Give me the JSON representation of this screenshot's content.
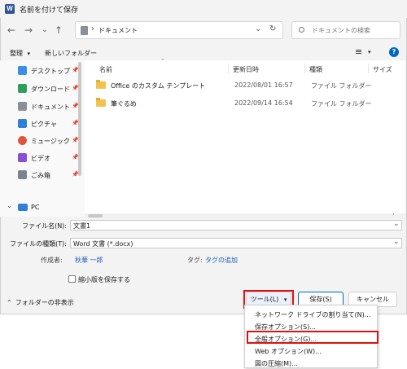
{
  "window": {
    "title": "名前を付けて保存",
    "app_icon_letter": "W",
    "app_color": "#2b579a"
  },
  "nav": {
    "back": "←",
    "forward": "→",
    "dropdown": "⌄",
    "up": "↑"
  },
  "address": {
    "separator": "›",
    "current": "ドキュメント",
    "chevron": "⌄",
    "refresh": "↻"
  },
  "search": {
    "placeholder": "ドキュメントの検索"
  },
  "toolbar": {
    "organize": "整理",
    "organize_arrow": "▾",
    "new_folder": "新しいフォルダー",
    "view_icon": "≡",
    "view_arrow": "▾",
    "help": "?"
  },
  "sidebar": {
    "items": [
      {
        "label": "デスクトップ",
        "icon": "desktop-icon",
        "color": "#3a8ee6",
        "pinned": true
      },
      {
        "label": "ダウンロード",
        "icon": "download-icon",
        "color": "#2f9e5d",
        "pinned": true
      },
      {
        "label": "ドキュメント",
        "icon": "document-icon",
        "color": "#8a8f98",
        "pinned": true
      },
      {
        "label": "ピクチャ",
        "icon": "picture-icon",
        "color": "#2f7fd8",
        "pinned": true
      },
      {
        "label": "ミュージック",
        "icon": "music-icon",
        "color": "#e0543c",
        "pinned": true
      },
      {
        "label": "ビデオ",
        "icon": "video-icon",
        "color": "#8a4fd6",
        "pinned": true
      },
      {
        "label": "ごみ箱",
        "icon": "recycle-bin-icon",
        "color": "#7a8491",
        "pinned": true
      }
    ],
    "pc": {
      "label": "PC",
      "chevron": "⌄"
    },
    "pin_glyph": "📌"
  },
  "columns": {
    "name": "名前",
    "date": "更新日時",
    "type": "種類",
    "size": "サイズ"
  },
  "files": [
    {
      "name": "Office のカスタム テンプレート",
      "date": "2022/08/01 16:57",
      "type": "ファイル フォルダー"
    },
    {
      "name": "筆ぐるめ",
      "date": "2022/09/14 16:54",
      "type": "ファイル フォルダー"
    }
  ],
  "form": {
    "filename_label": "ファイル名(N):",
    "filename_value": "文書1",
    "filetype_label": "ファイルの種類(T):",
    "filetype_value": "Word 文書 (*.docx)",
    "author_label": "作成者:",
    "author_value": "秋華 一郎",
    "tags_label": "タグ:",
    "tags_value": "タグの追加",
    "thumbnail_label": "縮小版を保存する"
  },
  "footer": {
    "hide_folders": "フォルダーの非表示",
    "tools": "ツール(L)",
    "tools_arrow": "▾",
    "save": "保存(S)",
    "cancel": "キャンセル"
  },
  "tools_menu": [
    "ネットワーク ドライブの割り当て(N)...",
    "保存オプション(S)...",
    "全般オプション(G)...",
    "Web オプション(W)...",
    "図の圧縮(M)..."
  ],
  "colors": {
    "highlight": "#e01010",
    "accent": "#0067c0"
  }
}
